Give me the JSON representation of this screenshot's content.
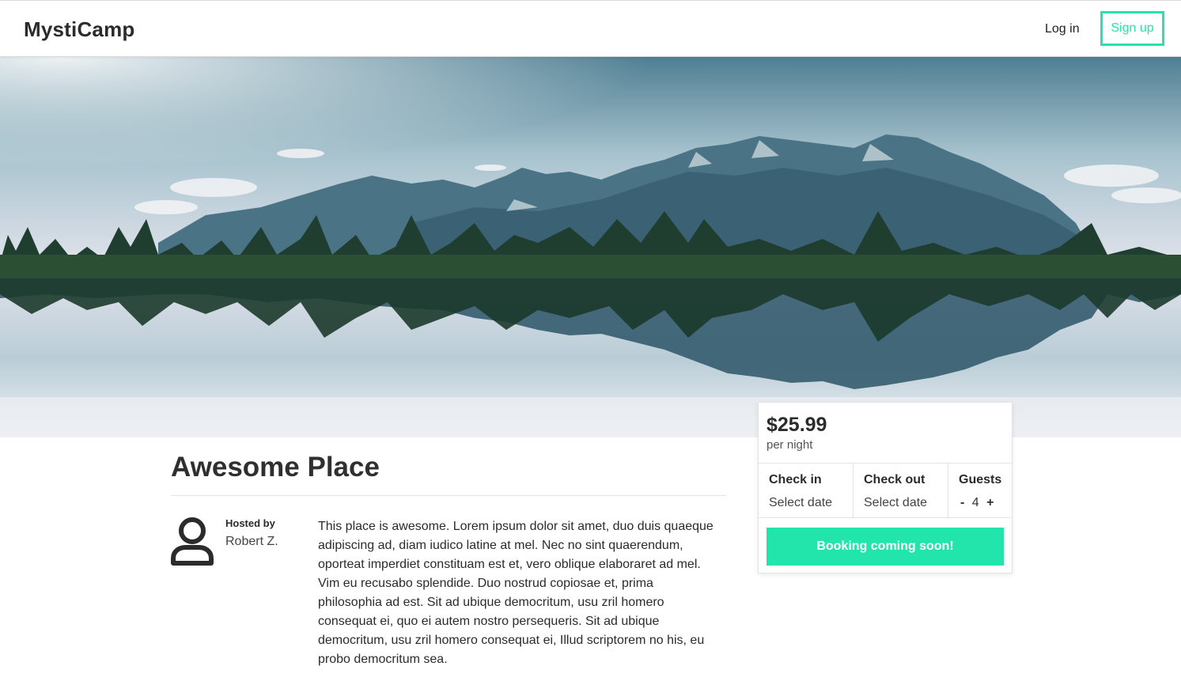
{
  "header": {
    "logo": "MystiCamp",
    "login_label": "Log in",
    "signup_label": "Sign up"
  },
  "listing": {
    "title": "Awesome Place",
    "hosted_by_label": "Hosted by",
    "host_name": "Robert Z.",
    "description": "This place is awesome. Lorem ipsum dolor sit amet, duo duis quaeque adipiscing ad, diam iudico latine at mel. Nec no sint quaerendum, oporteat imperdiet constituam est et, vero oblique elaboraret ad mel. Vim eu recusabo splendide. Duo nostrud copiosae et, prima philosophia ad est. Sit ad ubique democritum, usu zril homero consequat ei, quo ei autem nostro persequeris. Sit ad ubique democritum, usu zril homero consequat ei, Illud scriptorem no his, eu probo democritum sea."
  },
  "booking": {
    "price": "$25.99",
    "per_night": "per night",
    "check_in_label": "Check in",
    "check_in_value": "Select date",
    "check_out_label": "Check out",
    "check_out_value": "Select date",
    "guests_label": "Guests",
    "guests_minus": "-",
    "guests_count": "4",
    "guests_plus": "+",
    "button_label": "Booking coming soon!"
  },
  "icons": {
    "host_avatar": "user-outline-icon"
  },
  "colors": {
    "accent": "#22e5ac",
    "text": "#2b2b2b"
  }
}
